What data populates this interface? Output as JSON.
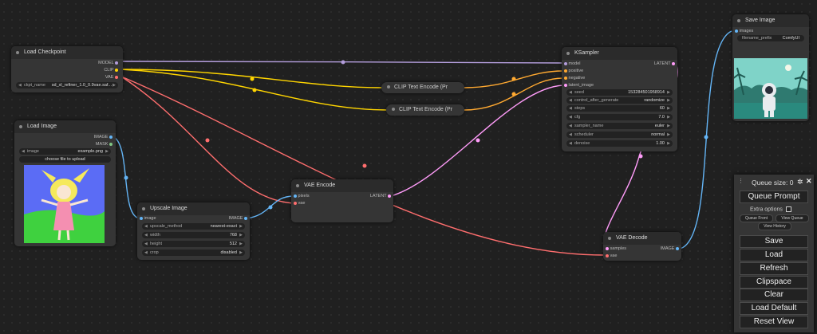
{
  "nodes": {
    "load_checkpoint": {
      "title": "Load Checkpoint",
      "outputs": [
        "MODEL",
        "CLIP",
        "VAE"
      ],
      "ckpt_label": "ckpt_name",
      "ckpt_value": "sd_xl_refiner_1.0_0.9vae.saf..."
    },
    "load_image": {
      "title": "Load Image",
      "outputs": [
        "IMAGE",
        "MASK"
      ],
      "image_label": "image",
      "image_value": "example.png",
      "upload_button": "choose file to upload"
    },
    "upscale_image": {
      "title": "Upscale Image",
      "input": "image",
      "output": "IMAGE",
      "widgets": [
        {
          "label": "upscale_method",
          "value": "nearest-exact"
        },
        {
          "label": "width",
          "value": "768"
        },
        {
          "label": "height",
          "value": "512"
        },
        {
          "label": "crop",
          "value": "disabled"
        }
      ]
    },
    "vae_encode": {
      "title": "VAE Encode",
      "inputs": [
        "pixels",
        "vae"
      ],
      "output": "LATENT"
    },
    "clip_text_1": {
      "title": "CLIP Text Encode (Pr"
    },
    "clip_text_2": {
      "title": "CLIP Text Encode (Pr"
    },
    "ksampler": {
      "title": "KSampler",
      "inputs": [
        "model",
        "positive",
        "negative",
        "latent_image"
      ],
      "output": "LATENT",
      "widgets": [
        {
          "label": "seed",
          "value": "153284501958914"
        },
        {
          "label": "control_after_generate",
          "value": "randomize"
        },
        {
          "label": "steps",
          "value": "60"
        },
        {
          "label": "cfg",
          "value": "7.0"
        },
        {
          "label": "sampler_name",
          "value": "euler"
        },
        {
          "label": "scheduler",
          "value": "normal"
        },
        {
          "label": "denoise",
          "value": "1.00"
        }
      ]
    },
    "vae_decode": {
      "title": "VAE Decode",
      "inputs": [
        "samples",
        "vae"
      ],
      "output": "IMAGE"
    },
    "save_image": {
      "title": "Save Image",
      "input": "images",
      "prefix_label": "filename_prefix",
      "prefix_value": "ComfyUI"
    }
  },
  "panel": {
    "queue_size": "Queue size: 0",
    "queue_prompt": "Queue Prompt",
    "extra_options": "Extra options",
    "queue_front": "Queue Front",
    "view_queue": "View Queue",
    "view_history": "View History",
    "save": "Save",
    "load": "Load",
    "refresh": "Refresh",
    "clipspace": "Clipspace",
    "clear": "Clear",
    "load_default": "Load Default",
    "reset_view": "Reset View"
  },
  "colors": {
    "model": "#b39ddb",
    "clip": "#ffd500",
    "vae": "#ff6e6e",
    "conditioning": "#ffa931",
    "latent": "#ff9cf9",
    "image": "#64b5f6",
    "node_bg": "#353535",
    "canvas_bg": "#202020"
  }
}
